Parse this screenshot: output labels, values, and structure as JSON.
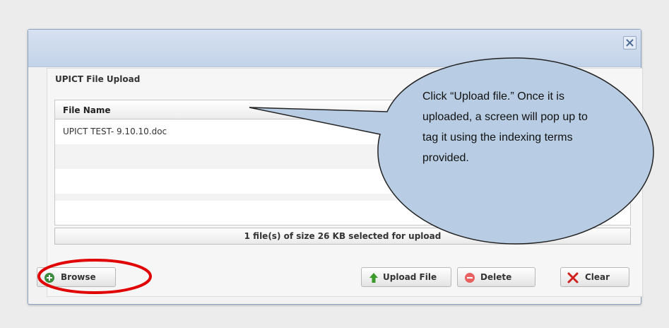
{
  "dialog": {
    "close_label": "×",
    "panel_title": "UPICT File Upload",
    "table": {
      "column_header": "File Name",
      "rows": [
        {
          "file_name": "UPICT TEST- 9.10.10.doc"
        },
        {
          "file_name": ""
        },
        {
          "file_name": ""
        },
        {
          "file_name": ""
        }
      ]
    },
    "status_text": "1 file(s) of size 26 KB selected for upload",
    "buttons": {
      "browse": "Browse",
      "upload": "Upload File",
      "delete": "Delete",
      "clear": "Clear"
    }
  },
  "callout": {
    "text": "Click “Upload file.” Once it is uploaded, a screen will pop up to tag it using the indexing terms provided."
  },
  "colors": {
    "titlebar": "#c6d5ea",
    "callout_fill": "#b8cde4",
    "highlight": "#e00000",
    "upload_icon": "#3a9a2a",
    "delete_icon": "#e05050",
    "clear_icon": "#d02020"
  },
  "icons": {
    "close": "close-x-icon",
    "browse": "add-circle-icon",
    "upload": "arrow-up-icon",
    "delete": "minus-circle-icon",
    "clear": "red-x-icon"
  }
}
